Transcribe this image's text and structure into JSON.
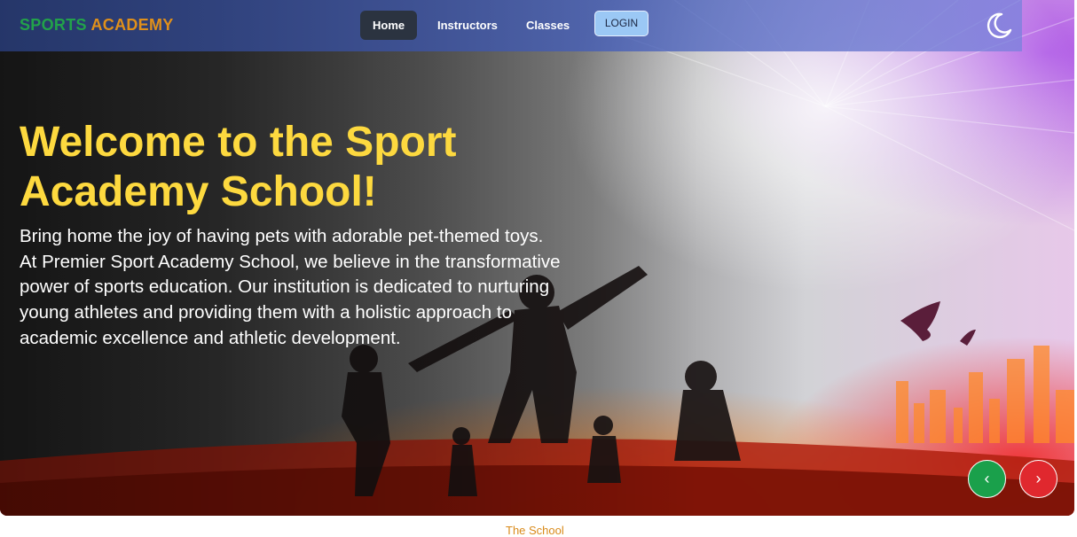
{
  "brand": {
    "word1": "SPORTS",
    "word2": "ACADEMY"
  },
  "nav": {
    "items": [
      {
        "label": "Home",
        "active": true
      },
      {
        "label": "Instructors"
      },
      {
        "label": "Classes"
      }
    ],
    "login_label": "LOGIN"
  },
  "theme_toggle": {
    "icon": "moon-icon"
  },
  "hero": {
    "title": "Welcome to the Sport Academy School!",
    "tagline": "Bring home the joy of having pets with adorable pet-themed toys.",
    "description": "At Premier Sport Academy School, we believe in the transformative power of sports education. Our institution is dedicated to nurturing young athletes and providing them with a holistic approach to academic excellence and athletic development."
  },
  "carousel": {
    "prev_symbol": "‹",
    "next_symbol": "›"
  },
  "footer": {
    "link_label": "The School"
  },
  "colors": {
    "title": "#fdd93f",
    "brand_green": "#22a24a",
    "brand_orange": "#e0901a",
    "prev_button": "#1aa04b",
    "next_button": "#e0282e"
  }
}
